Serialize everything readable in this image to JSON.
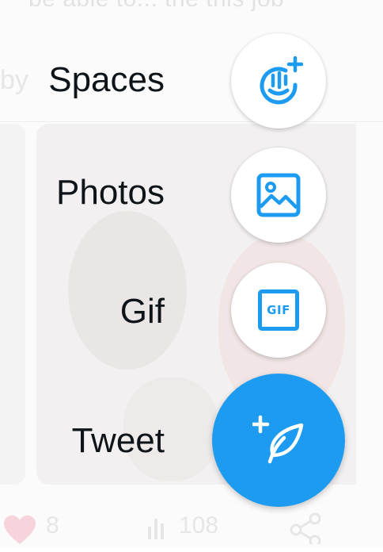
{
  "background": {
    "top_text": "be able to... the this job",
    "by_text": "by",
    "likes": "8",
    "views": "108"
  },
  "menu": {
    "items": [
      {
        "key": "spaces",
        "label": "Spaces",
        "icon": "spaces-plus-icon"
      },
      {
        "key": "photos",
        "label": "Photos",
        "icon": "image-icon"
      },
      {
        "key": "gif",
        "label": "Gif",
        "icon": "gif-icon"
      },
      {
        "key": "tweet",
        "label": "Tweet",
        "icon": "feather-plus-icon"
      }
    ],
    "gif_badge": "GIF"
  },
  "colors": {
    "accent": "#1d9bf0",
    "text": "#0f1419",
    "fab_bg": "#ffffff"
  }
}
